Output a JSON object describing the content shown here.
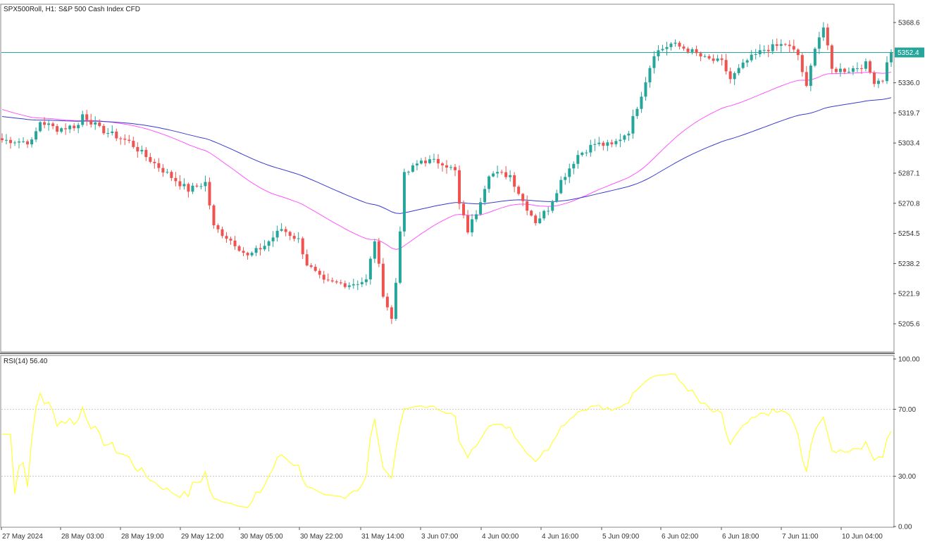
{
  "chart_data": {
    "type": "candlestick",
    "symbol": "SPX500Roll, H1:",
    "description": "S&P 500 Cash Index CFD",
    "current_price": "5352.4",
    "price_ticks": [
      "5368.6",
      "5352.4",
      "5336.0",
      "5319.7",
      "5303.4",
      "5287.1",
      "5270.8",
      "5254.5",
      "5238.2",
      "5221.9",
      "5205.6"
    ],
    "price_range": [
      5190,
      5374
    ],
    "time_labels": [
      "27 May 2024",
      "28 May 03:00",
      "28 May 19:00",
      "29 May 12:00",
      "30 May 05:00",
      "30 May 22:00",
      "31 May 14:00",
      "3 Jun 07:00",
      "4 Jun 00:00",
      "4 Jun 16:00",
      "5 Jun 09:00",
      "6 Jun 02:00",
      "6 Jun 18:00",
      "7 Jun 11:00",
      "10 Jun 04:00"
    ],
    "grid": false,
    "colors": {
      "up": "#26a69a",
      "down": "#ef5350",
      "ma_fast": "#ff55ff",
      "ma_slow": "#3a3acf",
      "rsi": "#ffff33",
      "price_line": "#26a69a"
    },
    "indicator": {
      "name": "RSI(14) 56.40",
      "ticks": [
        "100.00",
        "70.00",
        "30.00",
        "0.00"
      ],
      "levels": [
        70,
        30
      ],
      "range": [
        0,
        100
      ]
    }
  }
}
